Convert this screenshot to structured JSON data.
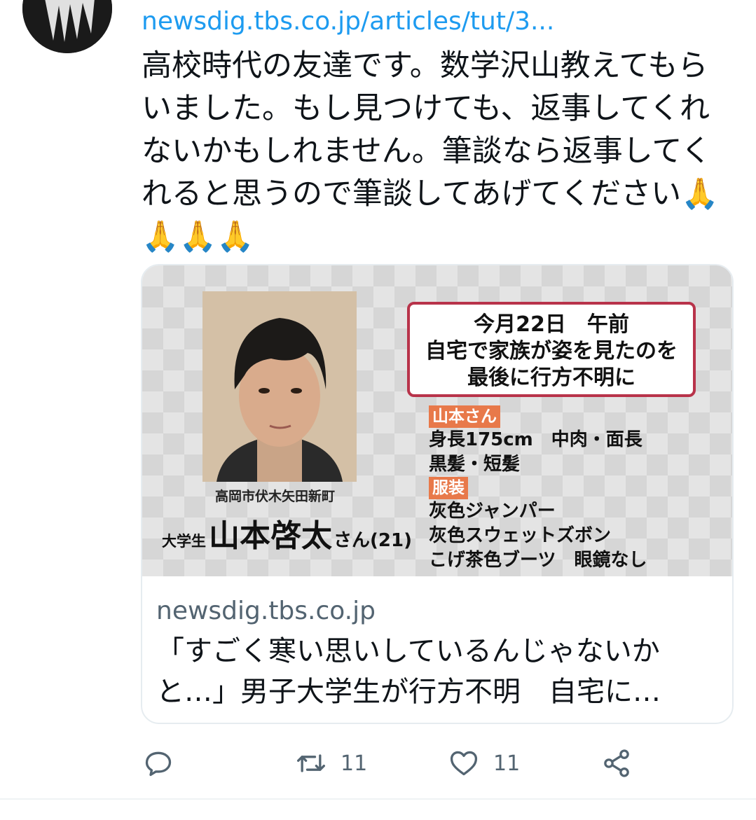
{
  "tweet": {
    "link": "newsdig.tbs.co.jp/articles/tut/3...",
    "text": "高校時代の友達です。数学沢山教えてもらいました。もし見つけても、返事してくれないかもしれません。筆談なら返事してくれると思うので筆談してあげてください🙏🙏🙏🙏"
  },
  "card": {
    "image": {
      "location": "高岡市伏木矢田新町",
      "person_prefix": "大学生",
      "person_name": "山本啓太",
      "person_suffix": "さん(21)",
      "box_line1": "今月22日　午前",
      "box_line2": "自宅で家族が姿を見たのを",
      "box_line3": "最後に行方不明に",
      "tag_name": "山本さん",
      "line_height": "身長175cm　中肉・面長",
      "line_hair": "黒髪・短髪",
      "tag_clothes": "服装",
      "line_cloth1": "灰色ジャンパー",
      "line_cloth2": "灰色スウェットズボン",
      "line_cloth3": "こげ茶色ブーツ　眼鏡なし"
    },
    "domain": "newsdig.tbs.co.jp",
    "title": "「すごく寒い思いしているんじゃないかと…」男子大学生が行方不明　自宅に…"
  },
  "actions": {
    "reply_icon": "reply-icon",
    "retweet_icon": "retweet-icon",
    "retweet_count": "11",
    "like_icon": "like-icon",
    "like_count": "11",
    "share_icon": "share-icon"
  },
  "colors": {
    "link": "#1d9bf0",
    "secondary_text": "#536471",
    "tag": "#e8794a",
    "box_border": "#b8334a"
  }
}
